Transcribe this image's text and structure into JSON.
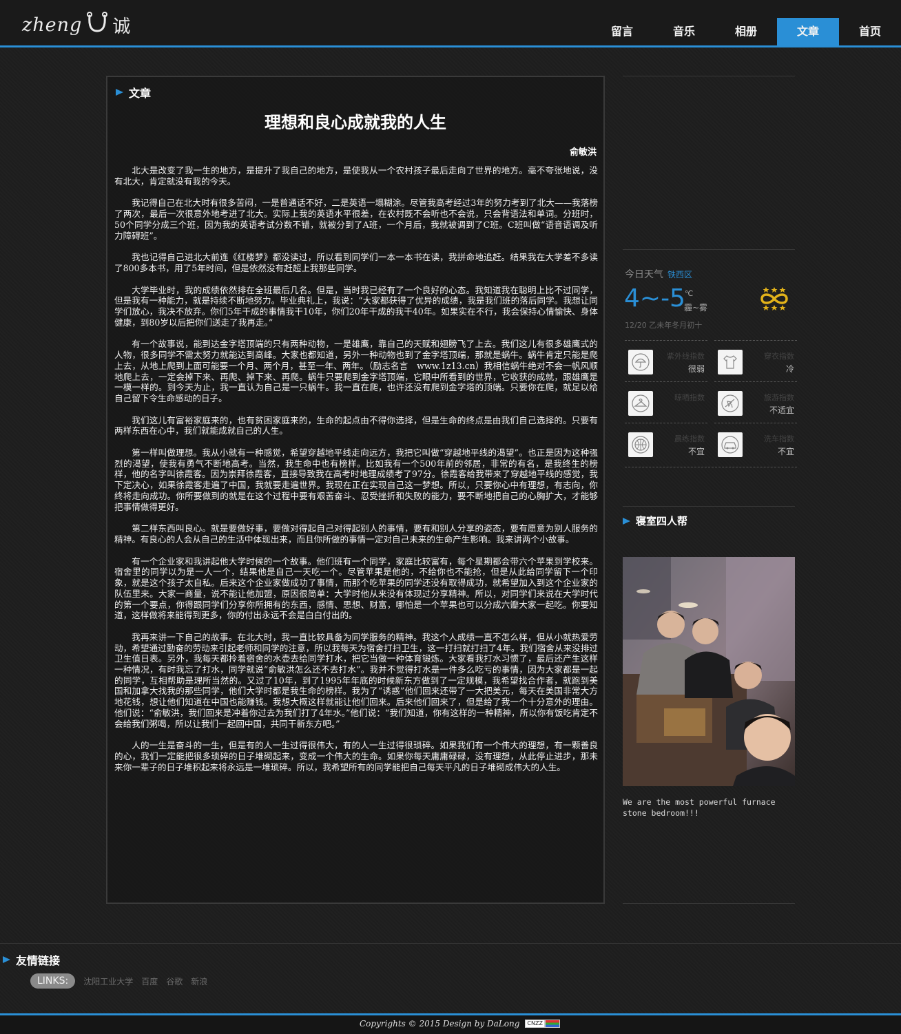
{
  "header": {
    "logo_text": "zheng",
    "logo_cn": "诚",
    "nav": [
      {
        "label": "留言",
        "active": false
      },
      {
        "label": "音乐",
        "active": false
      },
      {
        "label": "相册",
        "active": false
      },
      {
        "label": "文章",
        "active": true
      },
      {
        "label": "首页",
        "active": false
      }
    ]
  },
  "article": {
    "section_label": "文章",
    "title": "理想和良心成就我的人生",
    "author": "俞敏洪",
    "paragraphs": [
      "北大是改变了我一生的地方，是提升了我自己的地方，是使我从一个农村孩子最后走向了世界的地方。毫不夸张地说，没有北大，肯定就没有我的今天。",
      "我记得自己在北大时有很多苦闷，一是普通话不好，二是英语一塌糊涂。尽管我高考经过3年的努力考到了北大——我落榜了两次，最后一次很意外地考进了北大。实际上我的英语水平很差，在农村既不会听也不会说，只会背语法和单词。分班时，50个同学分成三个班，因为我的英语考试分数不错，就被分到了A班，一个月后，我就被调到了C班。C班叫做“语音语调及听力障碍班”。",
      "我也记得自己进北大前连《红楼梦》都没读过，所以看到同学们一本一本书在读，我拼命地追赶。结果我在大学差不多读了800多本书，用了5年时间，但是依然没有赶超上我那些同学。",
      "大学毕业时，我的成绩依然排在全班最后几名。但是，当时我已经有了一个良好的心态。我知道我在聪明上比不过同学，但是我有一种能力，就是持续不断地努力。毕业典礼上，我说：“大家都获得了优异的成绩，我是我们班的落后同学。我想让同学们放心，我决不放弃。你们5年干成的事情我干10年，你们20年干成的我干40年。如果实在不行，我会保持心情愉快、身体健康，到80岁以后把你们送走了我再走。”",
      "有一个故事说，能到达金字塔顶端的只有两种动物，一是雄鹰，靠自己的天赋和翅膀飞了上去。我们这儿有很多雄鹰式的人物，很多同学不需太努力就能达到高峰。大家也都知道，另外一种动物也到了金字塔顶端，那就是蜗牛。蜗牛肯定只能是爬上去，从地上爬到上面可能要一个月、两个月，甚至一年、两年。（励志名言　www.1z13.cn）我相信蜗牛绝对不会一帆风顺地爬上去，一定会掉下来、再爬、掉下来、再爬。蜗牛只要爬到金字塔顶端，它眼中所看到的世界，它收获的成就，跟雄鹰是一模一样的。到今天为止，我一直认为自己是一只蜗牛。我一直在爬，也许还没有爬到金字塔的顶端。只要你在爬，就足以给自己留下令生命感动的日子。",
      "我们这儿有富裕家庭来的，也有贫困家庭来的，生命的起点由不得你选择，但是生命的终点是由我们自己选择的。只要有两样东西在心中，我们就能成就自己的人生。",
      "第一样叫做理想。我从小就有一种感觉，希望穿越地平线走向远方，我把它叫做“穿越地平线的渴望”。也正是因为这种强烈的渴望，使我有勇气不断地高考。当然，我生命中也有榜样。比如我有一个500年前的邻居，非常的有名，是我终生的榜样，他的名字叫徐霞客。因为崇拜徐霞客，直接导致我在高考时地理成绩考了97分。徐霞客给我带来了穿越地平线的感觉，我下定决心，如果徐霞客走遍了中国，我就要走遍世界。我现在正在实现自己这一梦想。所以，只要你心中有理想，有志向，你终将走向成功。你所要做到的就是在这个过程中要有艰苦奋斗、忍受挫折和失败的能力，要不断地把自己的心胸扩大，才能够把事情做得更好。",
      "第二样东西叫良心。就是要做好事，要做对得起自己对得起别人的事情，要有和别人分享的姿态，要有愿意为别人服务的精神。有良心的人会从自己的生活中体现出来，而且你所做的事情一定对自己未来的生命产生影响。我来讲两个小故事。",
      "有一个企业家和我讲起他大学时候的一个故事。他们班有一个同学，家庭比较富有，每个星期都会带六个苹果到学校来。宿舍里的同学以为是一人一个，结果他是自己一天吃一个。尽管苹果是他的，不给你也不能抢，但是从此给同学留下一个印象，就是这个孩子太自私。后来这个企业家做成功了事情，而那个吃苹果的同学还没有取得成功，就希望加入到这个企业家的队伍里来。大家一商量，说不能让他加盟，原因很简单：大学时他从来没有体现过分享精神。所以，对同学们来说在大学时代的第一个要点，你得跟同学们分享你所拥有的东西，感情、思想、财富，哪怕是一个苹果也可以分成六瓣大家一起吃。你要知道，这样做将来能得到更多，你的付出永远不会是白白付出的。",
      "我再来讲一下自己的故事。在北大时，我一直比较具备为同学服务的精神。我这个人成绩一直不怎么样，但从小就热爱劳动，希望通过勤奋的劳动来引起老师和同学的注意，所以我每天为宿舍打扫卫生，这一打扫就打扫了4年。我们宿舍从来没排过卫生值日表。另外，我每天都拎着宿舍的水壶去给同学打水，把它当做一种体育锻炼。大家看我打水习惯了，最后还产生这样一种情况，有时我忘了打水，同学就说“俞敏洪怎么还不去打水”。我并不觉得打水是一件多么吃亏的事情，因为大家都是一起的同学，互相帮助是理所当然的。又过了10年，到了1995年年底的时候新东方做到了一定规模，我希望找合作者，就跑到美国和加拿大找我的那些同学，他们大学时都是我生命的榜样。我为了“诱惑”他们回来还带了一大把美元，每天在美国非常大方地花钱，想让他们知道在中国也能赚钱。我想大概这样就能让他们回来。后来他们回来了，但是给了我一个十分意外的理由。他们说：“俞敏洪，我们回来是冲着你过去为我们打了4年水。”他们说：“我们知道，你有这样的一种精神，所以你有饭吃肯定不会给我们粥喝，所以让我们一起回中国，共同干新东方吧。”",
      "人的一生是奋斗的一生，但是有的人一生过得很伟大，有的人一生过得很琐碎。如果我们有一个伟大的理想，有一颗善良的心，我们一定能把很多琐碎的日子堆砌起来，变成一个伟大的生命。如果你每天庸庸碌碌，没有理想，从此停止进步，那未来你一辈子的日子堆积起来将永远是一堆琐碎。所以，我希望所有的同学能把自己每天平凡的日子堆砌成伟大的人生。"
    ]
  },
  "weather": {
    "title": "今日天气",
    "city": "铁西区",
    "temp": "4~-5",
    "unit": "℃",
    "desc": "霾~雾",
    "date": "12/20 乙未年冬月初十",
    "accent_color": "#2a8fd6",
    "indices": [
      {
        "icon": "umbrella-icon",
        "label": "紫外线指数",
        "value": "很弱"
      },
      {
        "icon": "shirt-icon",
        "label": "穿衣指数",
        "value": "冷"
      },
      {
        "icon": "hanger-icon",
        "label": "晾晒指数",
        "value": ""
      },
      {
        "icon": "plane-icon",
        "label": "旅游指数",
        "value": "不适宜"
      },
      {
        "icon": "basketball-icon",
        "label": "晨练指数",
        "value": "不宜"
      },
      {
        "icon": "car-icon",
        "label": "洗车指数",
        "value": "不宜"
      }
    ]
  },
  "sidebar": {
    "group_title": "寝室四人帮",
    "photo_caption": "We are the most powerful furnace stone bedroom!!!"
  },
  "footer": {
    "friend_title": "友情链接",
    "links_label": "LINKS:",
    "links": [
      "沈阳工业大学",
      "百度",
      "谷歌",
      "新浪"
    ],
    "copyright": "Copyrights © 2015 Design by DaLong",
    "badge": "CNZZ"
  }
}
